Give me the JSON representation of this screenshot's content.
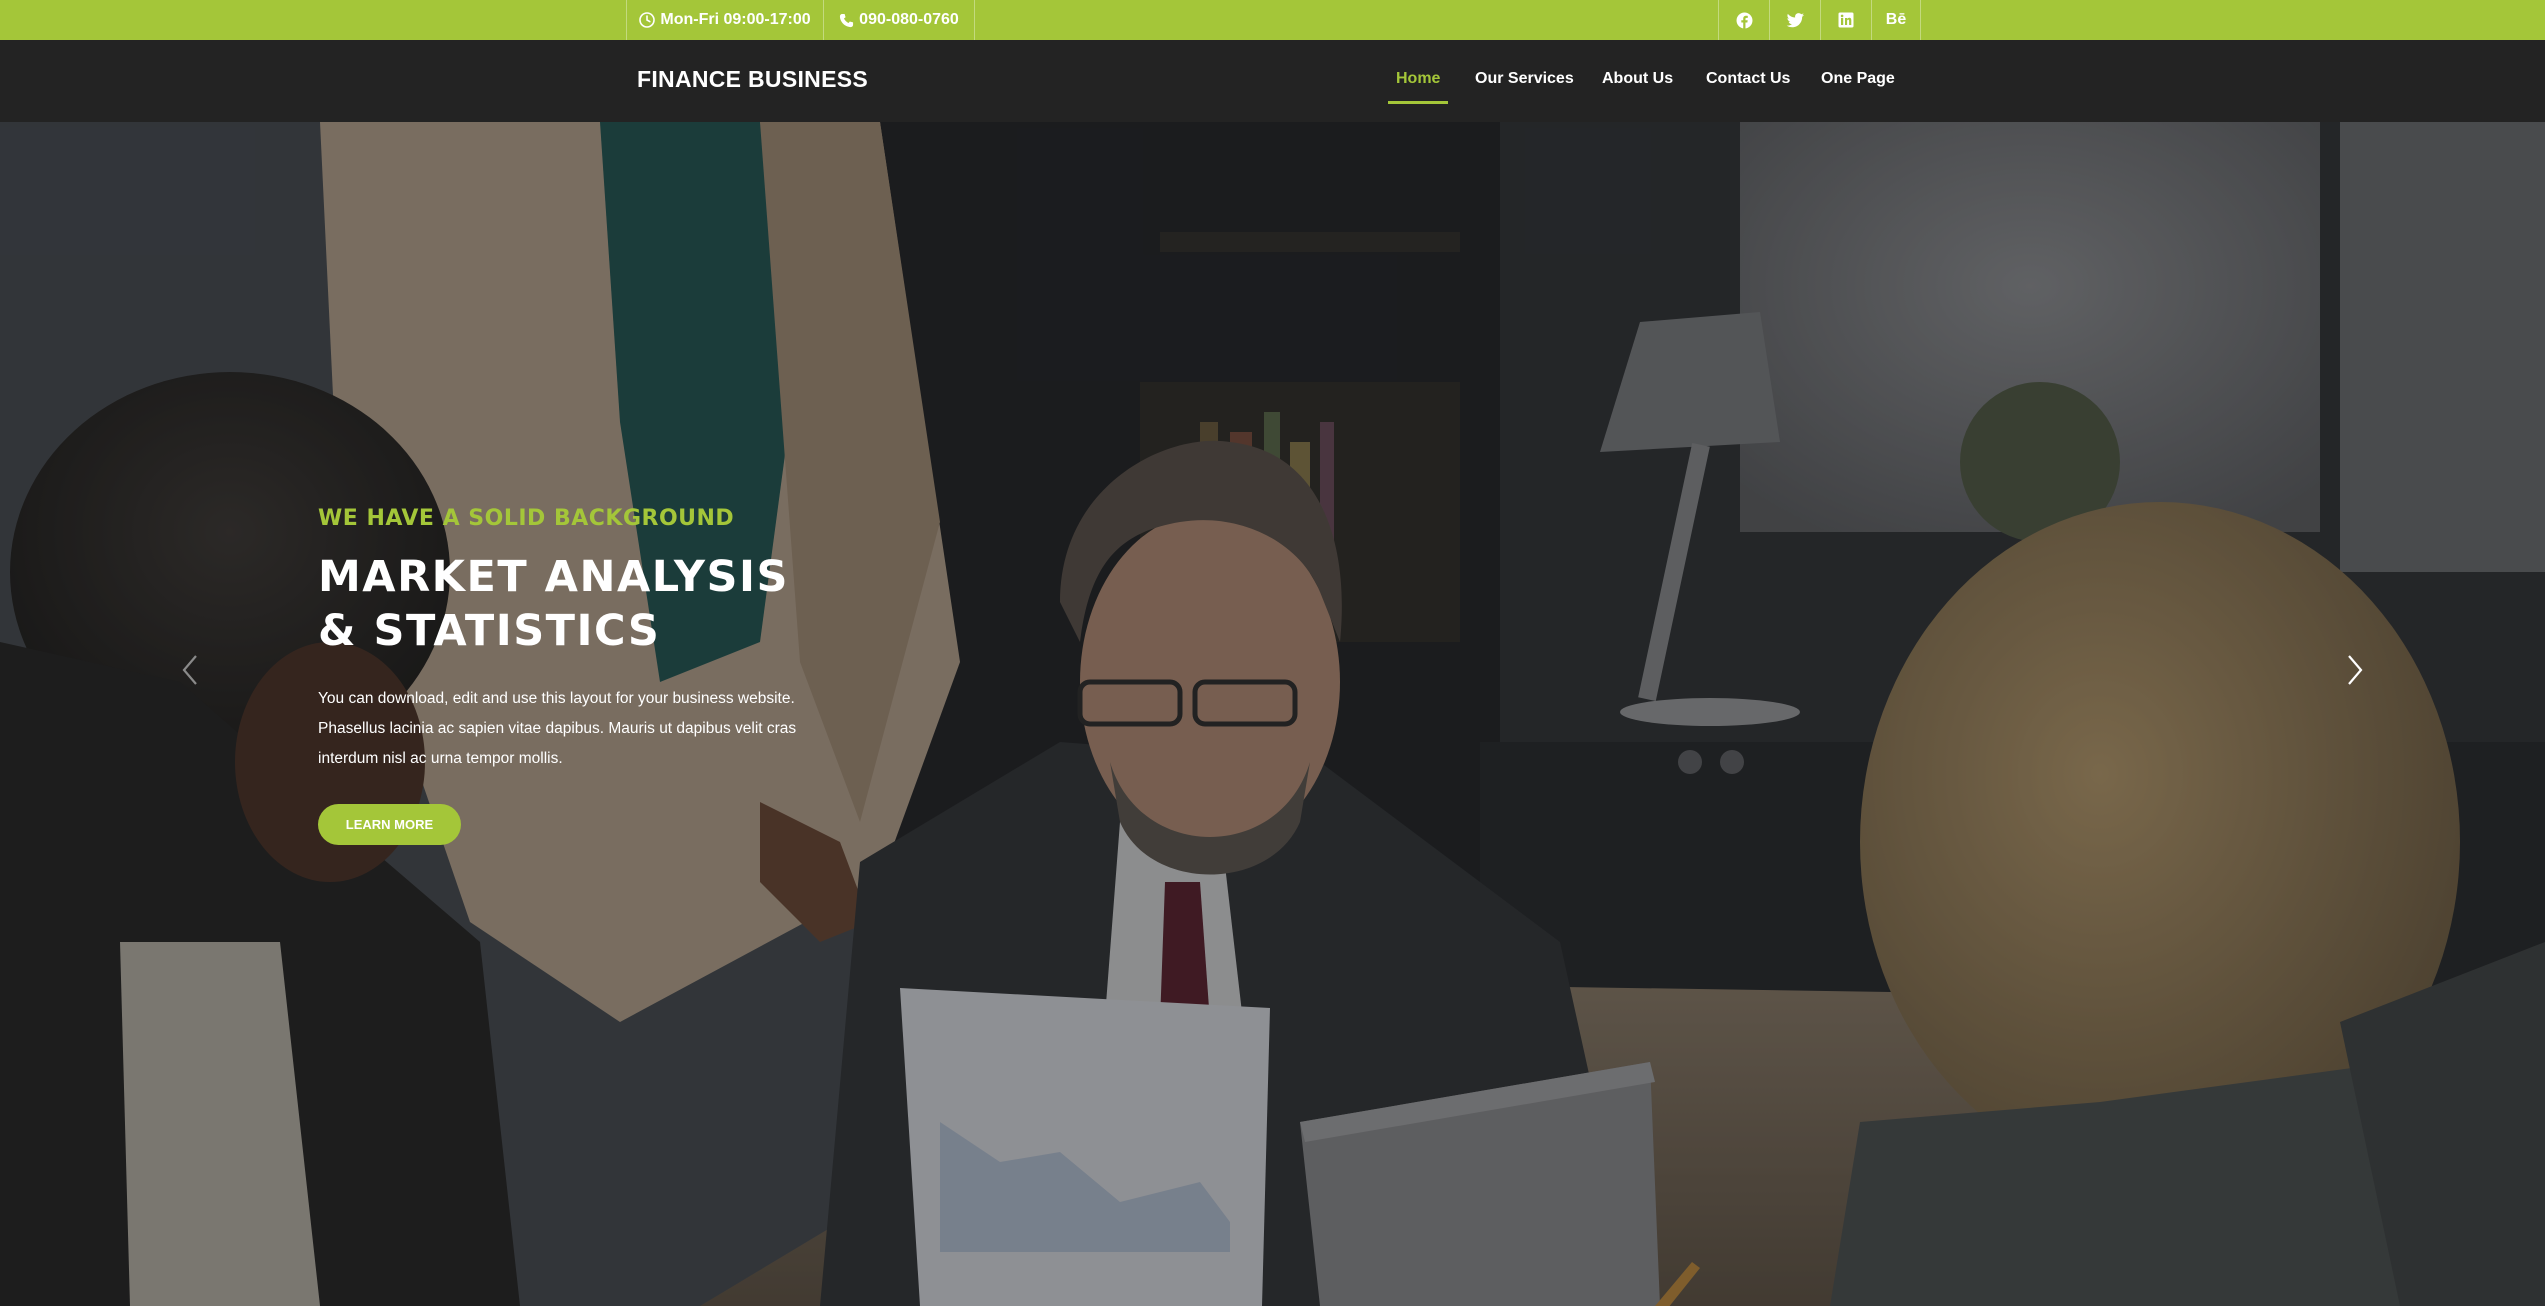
{
  "topbar": {
    "hours_icon": "clock-icon",
    "hours": "Mon-Fri 09:00-17:00",
    "phone_icon": "phone-icon",
    "phone": "090-080-0760",
    "social": [
      {
        "icon": "facebook-icon"
      },
      {
        "icon": "twitter-icon"
      },
      {
        "icon": "linkedin-icon"
      },
      {
        "icon": "behance-icon",
        "text": "Bē"
      }
    ]
  },
  "nav": {
    "brand": "FINANCE BUSINESS",
    "items": [
      {
        "label": "Home",
        "active": true
      },
      {
        "label": "Our Services"
      },
      {
        "label": "About Us"
      },
      {
        "label": "Contact Us"
      },
      {
        "label": "One Page"
      }
    ]
  },
  "hero": {
    "kicker": "WE HAVE A SOLID BACKGROUND",
    "headline_line1": "MARKET ANALYSIS",
    "headline_line2": "& STATISTICS",
    "lead_line1": "You can download, edit and use this layout for your business website.",
    "lead_line2": "Phasellus lacinia ac sapien vitae dapibus. Mauris ut dapibus velit cras",
    "lead_line3": "interdum nisl ac urna tempor mollis.",
    "cta": "LEARN MORE",
    "prev_icon": "chevron-left-icon",
    "next_icon": "chevron-right-icon"
  },
  "colors": {
    "accent": "#a4c639",
    "nav_bg": "#232323",
    "text": "#ffffff"
  }
}
